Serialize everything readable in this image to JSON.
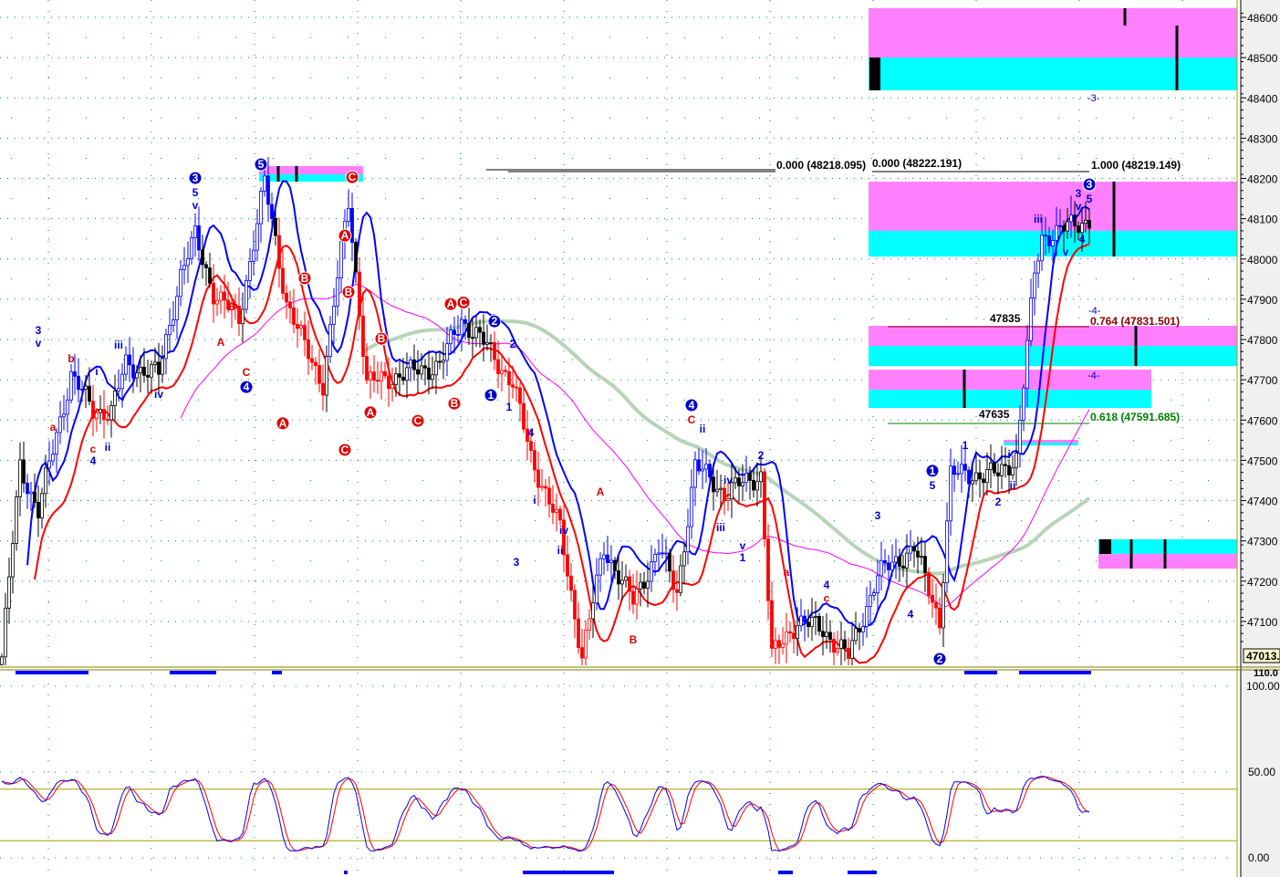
{
  "chart_data": {
    "type": "candlestick",
    "title": "",
    "price_axis": {
      "min": 47013,
      "max": 48620,
      "ticks": [
        48600,
        48500,
        48400,
        48300,
        48200,
        48100,
        48000,
        47900,
        47800,
        47700,
        47600,
        47500,
        47400,
        47300,
        47200,
        47100
      ],
      "last_price_label": "47013."
    },
    "oscillator_axis": {
      "ticks": [
        "100.00",
        "50.00",
        "0.00"
      ],
      "top_label": "110.0",
      "levels": [
        80,
        20
      ]
    },
    "close_waypoints": [
      [
        0,
        47012
      ],
      [
        5,
        47487
      ],
      [
        10,
        47374
      ],
      [
        19,
        47714
      ],
      [
        25,
        47623
      ],
      [
        30,
        47623
      ],
      [
        34,
        47737
      ],
      [
        43,
        47714
      ],
      [
        49,
        47963
      ],
      [
        53,
        48054
      ],
      [
        58,
        47918
      ],
      [
        65,
        47850
      ],
      [
        72,
        48190
      ],
      [
        78,
        47895
      ],
      [
        83,
        47782
      ],
      [
        88,
        47691
      ],
      [
        95,
        48145
      ],
      [
        100,
        47691
      ],
      [
        110,
        47714
      ],
      [
        120,
        47737
      ],
      [
        126,
        47850
      ],
      [
        133,
        47782
      ],
      [
        140,
        47691
      ],
      [
        145,
        47510
      ],
      [
        153,
        47329
      ],
      [
        159,
        47012
      ],
      [
        165,
        47283
      ],
      [
        173,
        47148
      ],
      [
        180,
        47283
      ],
      [
        185,
        47170
      ],
      [
        190,
        47487
      ],
      [
        198,
        47419
      ],
      [
        208,
        47465
      ],
      [
        211,
        47012
      ],
      [
        218,
        47102
      ],
      [
        225,
        47080
      ],
      [
        232,
        47012
      ],
      [
        240,
        47215
      ],
      [
        250,
        47283
      ],
      [
        257,
        47102
      ],
      [
        260,
        47465
      ],
      [
        273,
        47465
      ],
      [
        278,
        47510
      ],
      [
        283,
        47963
      ],
      [
        285,
        48054
      ],
      [
        298,
        48099
      ]
    ],
    "series": [
      {
        "name": "fast-ma",
        "color": "#0000ff"
      },
      {
        "name": "slow-ma",
        "color": "#ff0000"
      },
      {
        "name": "mid-ma",
        "color": "#ff00ff"
      },
      {
        "name": "long-ma",
        "color": "#b0ccb0"
      },
      {
        "name": "stoch-k",
        "color": "#0000ff"
      },
      {
        "name": "stoch-d",
        "color": "#ff0000"
      }
    ],
    "zones": [
      {
        "from_bar": 238,
        "to_bar": 340,
        "magenta": [
          48500,
          48623
        ],
        "cyan": [
          48419,
          48500
        ]
      },
      {
        "from_bar": 238,
        "to_bar": 340,
        "magenta": [
          48070,
          48192
        ],
        "cyan": [
          48006,
          48070
        ]
      },
      {
        "from_bar": 238,
        "to_bar": 340,
        "magenta": [
          47784,
          47834
        ],
        "cyan": [
          47734,
          47784
        ]
      },
      {
        "from_bar": 238,
        "to_bar": 315,
        "magenta": [
          47675,
          47725
        ],
        "cyan": [
          47630,
          47675
        ]
      },
      {
        "from_bar": 301,
        "to_bar": 340,
        "magenta": [
          47231,
          47268
        ],
        "cyan": [
          47268,
          47304
        ]
      },
      {
        "from_bar": 71,
        "to_bar": 99,
        "magenta": [
          48210,
          48231
        ],
        "cyan": [
          48192,
          48210
        ]
      },
      {
        "from_bar": 275,
        "to_bar": 295,
        "magenta": [
          47544,
          47551
        ],
        "cyan": [
          47537,
          47544
        ]
      }
    ],
    "fib_levels": [
      {
        "label": "0.000 (48218.095)",
        "price": 48218,
        "color": "#000000"
      },
      {
        "label": "0.000 (48222.191)",
        "price": 48222,
        "color": "#000000"
      },
      {
        "label": "1.000 (48219.149)",
        "price": 48219,
        "color": "#000000"
      },
      {
        "label": "0.764 (47831.501)",
        "price": 47831.501,
        "color": "#8b0000"
      },
      {
        "label": "0.618 (47591.685)",
        "price": 47591.685,
        "color": "#008000"
      }
    ],
    "price_marks": [
      "47835",
      "47635"
    ],
    "wave_markers": [
      "-3-",
      "-4-",
      "-4-"
    ],
    "labels": [
      {
        "t": "3",
        "bar": 53,
        "p": 48201,
        "c": "#0000cc",
        "circ": true
      },
      {
        "t": "5",
        "bar": 53,
        "p": 48165,
        "c": "#0000cc"
      },
      {
        "t": "v",
        "bar": 53,
        "p": 48133,
        "c": "#0000cc"
      },
      {
        "t": "5",
        "bar": 71,
        "p": 48235,
        "c": "#0000cc",
        "circ": true
      },
      {
        "t": "C",
        "bar": 96,
        "p": 48203,
        "c": "#e00000",
        "circ": true
      },
      {
        "t": "A",
        "bar": 94,
        "p": 48058,
        "c": "#e00000",
        "circ": true
      },
      {
        "t": "B",
        "bar": 83,
        "p": 47952,
        "c": "#e00000",
        "circ": true
      },
      {
        "t": "B",
        "bar": 95,
        "p": 47918,
        "c": "#e00000",
        "circ": true
      },
      {
        "t": "B",
        "bar": 104,
        "p": 47802,
        "c": "#e00000",
        "circ": true
      },
      {
        "t": "A",
        "bar": 77,
        "p": 47592,
        "c": "#e00000",
        "circ": true
      },
      {
        "t": "C",
        "bar": 94,
        "p": 47526,
        "c": "#e00000",
        "circ": true
      },
      {
        "t": "A",
        "bar": 101,
        "p": 47619,
        "c": "#e00000",
        "circ": true
      },
      {
        "t": "C",
        "bar": 114,
        "p": 47598,
        "c": "#e00000",
        "circ": true
      },
      {
        "t": "B",
        "bar": 124,
        "p": 47641,
        "c": "#e00000",
        "circ": true
      },
      {
        "t": "A",
        "bar": 123,
        "p": 47888,
        "c": "#e00000",
        "circ": true
      },
      {
        "t": "C",
        "bar": 126.5,
        "p": 47892,
        "c": "#e00000",
        "circ": true
      },
      {
        "t": "4",
        "bar": 67,
        "p": 47682,
        "c": "#0000cc",
        "circ": true
      },
      {
        "t": "2",
        "bar": 135,
        "p": 47845,
        "c": "#0000cc",
        "circ": true
      },
      {
        "t": "1",
        "bar": 134,
        "p": 47662,
        "c": "#0000cc",
        "circ": true
      },
      {
        "t": "4",
        "bar": 189,
        "p": 47637,
        "c": "#0000cc",
        "circ": true
      },
      {
        "t": "1",
        "bar": 255,
        "p": 47474,
        "c": "#0000cc",
        "circ": true
      },
      {
        "t": "2",
        "bar": 257,
        "p": 47007,
        "c": "#0000cc",
        "circ": true
      },
      {
        "t": "3",
        "bar": 298,
        "p": 48185,
        "c": "#0000cc",
        "circ": true
      },
      {
        "t": "3",
        "bar": 10,
        "p": 47823,
        "c": "#0000cc"
      },
      {
        "t": "v",
        "bar": 10,
        "p": 47791,
        "c": "#0000cc"
      },
      {
        "t": "iii",
        "bar": 32,
        "p": 47787,
        "c": "#0000cc"
      },
      {
        "t": "i",
        "bar": 26,
        "p": 47721,
        "c": "#0000cc"
      },
      {
        "t": "ii",
        "bar": 29,
        "p": 47533,
        "c": "#0000cc"
      },
      {
        "t": "4",
        "bar": 25,
        "p": 47499,
        "c": "#0000cc"
      },
      {
        "t": "iv",
        "bar": 43,
        "p": 47664,
        "c": "#0000cc"
      },
      {
        "t": "1",
        "bar": 139,
        "p": 47632,
        "c": "#0000cc"
      },
      {
        "t": "2",
        "bar": 140,
        "p": 47789,
        "c": "#0000cc"
      },
      {
        "t": "3",
        "bar": 141,
        "p": 47247,
        "c": "#0000cc"
      },
      {
        "t": "4",
        "bar": 145,
        "p": 47569,
        "c": "#0000cc"
      },
      {
        "t": "i",
        "bar": 146,
        "p": 47401,
        "c": "#0000cc"
      },
      {
        "t": "ii",
        "bar": 153,
        "p": 47277,
        "c": "#0000cc"
      },
      {
        "t": "iv",
        "bar": 154,
        "p": 47326,
        "c": "#0000cc"
      },
      {
        "t": "ii",
        "bar": 192,
        "p": 47578,
        "c": "#0000cc"
      },
      {
        "t": "iv",
        "bar": 199,
        "p": 47451,
        "c": "#0000cc"
      },
      {
        "t": "iii",
        "bar": 197,
        "p": 47333,
        "c": "#0000cc"
      },
      {
        "t": "v",
        "bar": 203,
        "p": 47288,
        "c": "#0000cc"
      },
      {
        "t": "1",
        "bar": 203,
        "p": 47259,
        "c": "#0000cc"
      },
      {
        "t": "2",
        "bar": 208,
        "p": 47512,
        "c": "#0000cc"
      },
      {
        "t": "4",
        "bar": 226,
        "p": 47190,
        "c": "#0000cc"
      },
      {
        "t": "3",
        "bar": 240,
        "p": 47363,
        "c": "#0000cc"
      },
      {
        "t": "4",
        "bar": 249,
        "p": 47118,
        "c": "#0000cc"
      },
      {
        "t": "5",
        "bar": 255,
        "p": 47437,
        "c": "#0000cc"
      },
      {
        "t": "1",
        "bar": 264,
        "p": 47537,
        "c": "#0000cc"
      },
      {
        "t": "2",
        "bar": 273,
        "p": 47397,
        "c": "#0000cc"
      },
      {
        "t": "i",
        "bar": 276,
        "p": 47515,
        "c": "#0000cc"
      },
      {
        "t": "ii",
        "bar": 277,
        "p": 47437,
        "c": "#0000cc"
      },
      {
        "t": "iii",
        "bar": 284,
        "p": 48099,
        "c": "#0000cc"
      },
      {
        "t": "3",
        "bar": 295,
        "p": 48163,
        "c": "#0000cc"
      },
      {
        "t": "v",
        "bar": 295,
        "p": 48131,
        "c": "#0000cc"
      },
      {
        "t": "v",
        "bar": 291.5,
        "p": 48018,
        "c": "#0000cc"
      },
      {
        "t": "4",
        "bar": 296,
        "p": 48049,
        "c": "#0000cc"
      },
      {
        "t": "5",
        "bar": 298,
        "p": 48149,
        "c": "#0000cc"
      },
      {
        "t": "a",
        "bar": 14,
        "p": 47583,
        "c": "#e00000"
      },
      {
        "t": "b",
        "bar": 19,
        "p": 47753,
        "c": "#e00000"
      },
      {
        "t": "c",
        "bar": 25,
        "p": 47528,
        "c": "#e00000"
      },
      {
        "t": "A",
        "bar": 60,
        "p": 47793,
        "c": "#e00000"
      },
      {
        "t": "B",
        "bar": 63,
        "p": 47882,
        "c": "#e00000"
      },
      {
        "t": "C",
        "bar": 67,
        "p": 47718,
        "c": "#e00000"
      },
      {
        "t": "A",
        "bar": 164,
        "p": 47422,
        "c": "#e00000"
      },
      {
        "t": "B",
        "bar": 173,
        "p": 47055,
        "c": "#e00000"
      },
      {
        "t": "C",
        "bar": 189,
        "p": 47601,
        "c": "#e00000"
      },
      {
        "t": "a",
        "bar": 215,
        "p": 47222,
        "c": "#e00000"
      },
      {
        "t": "c",
        "bar": 226,
        "p": 47158,
        "c": "#e00000"
      }
    ]
  },
  "colors": {
    "magenta": "#ff80ff",
    "cyan": "#00ffff",
    "grid": "#008080",
    "axis_bg": "#f0f0f0",
    "level": "#a0a000"
  }
}
